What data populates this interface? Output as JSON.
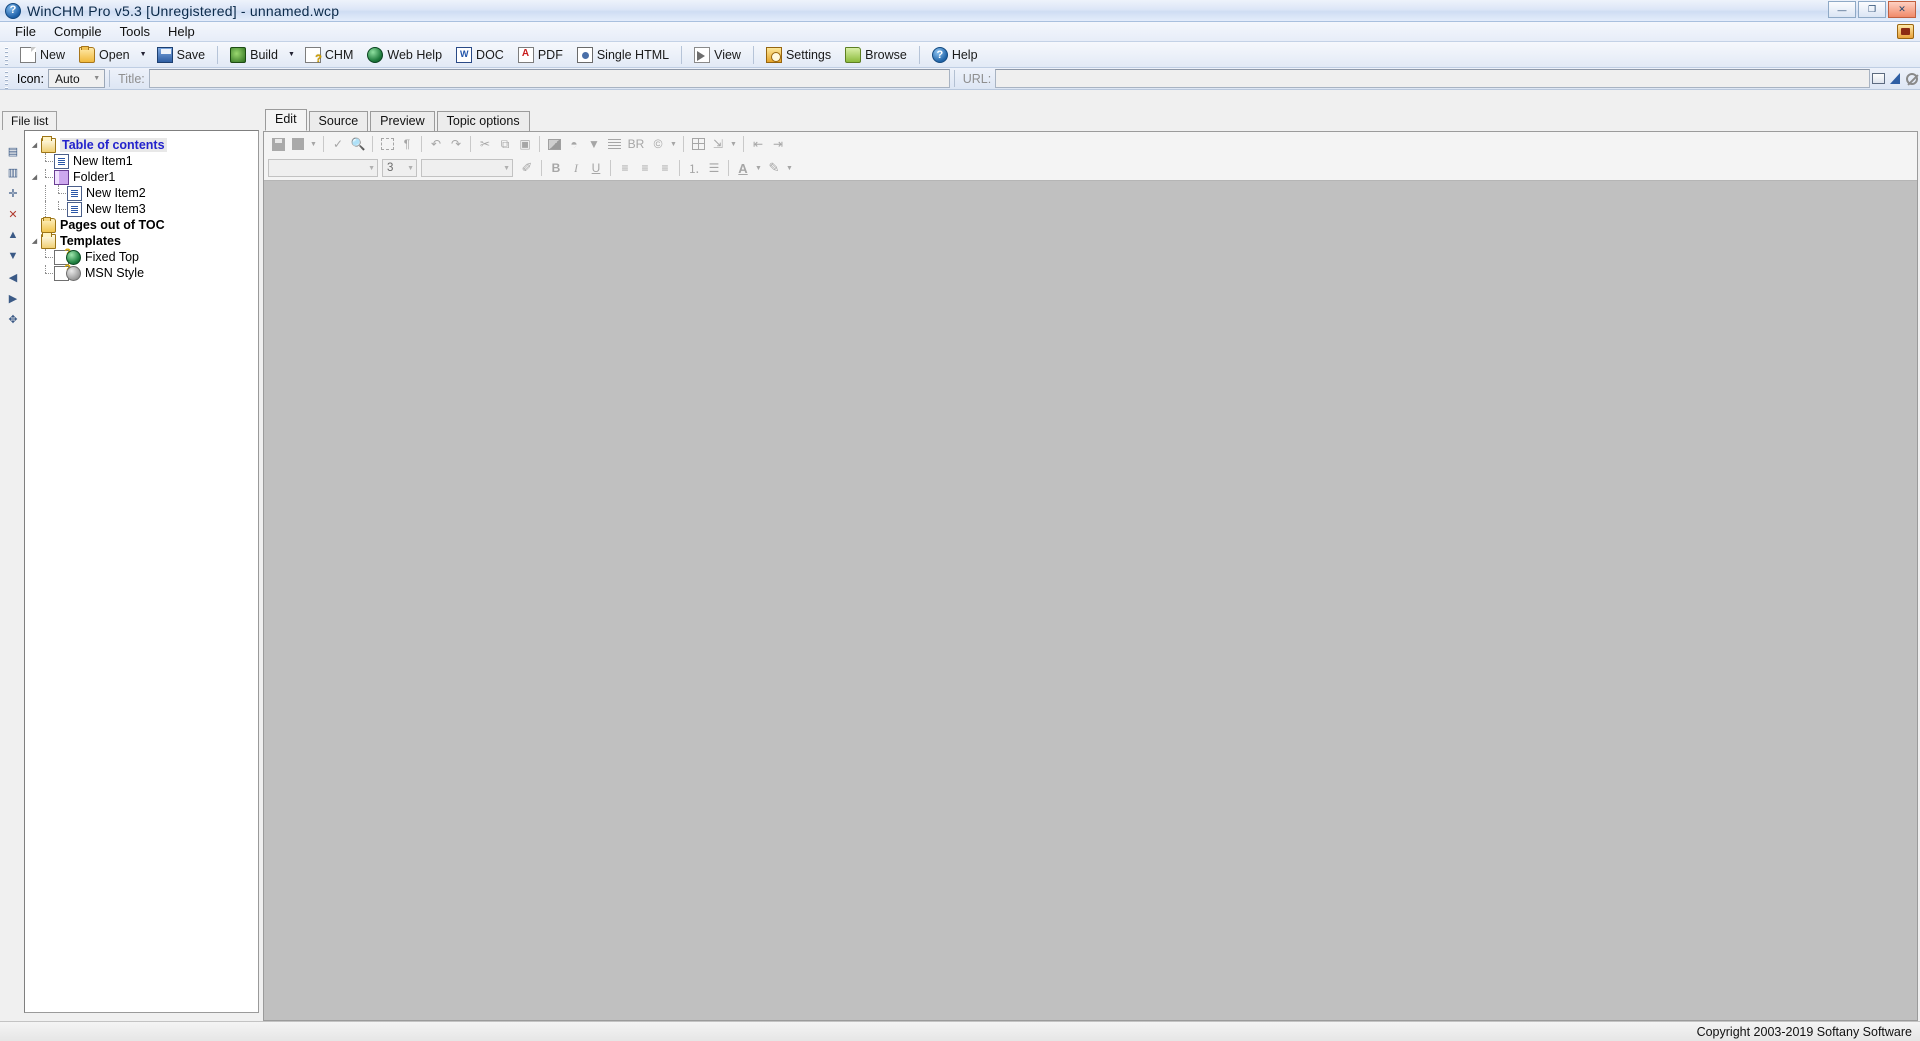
{
  "window": {
    "title": "WinCHM Pro v5.3 [Unregistered] - unnamed.wcp",
    "app_icon": "question-globe-icon",
    "minimize_label": "—",
    "maximize_label": "❐",
    "close_label": "✕"
  },
  "menu": {
    "items": [
      {
        "label": "File"
      },
      {
        "label": "Compile"
      },
      {
        "label": "Tools"
      },
      {
        "label": "Help"
      }
    ],
    "right_icon": "register-key-icon"
  },
  "toolbar": {
    "buttons": [
      {
        "label": "New",
        "icon": "new-page-icon",
        "dropdown": false
      },
      {
        "label": "Open",
        "icon": "open-folder-icon",
        "dropdown": true
      },
      {
        "label": "Save",
        "icon": "save-disk-icon",
        "dropdown": false
      },
      {
        "label": "Build",
        "icon": "build-icon",
        "dropdown": true
      },
      {
        "label": "CHM",
        "icon": "chm-file-icon",
        "dropdown": false
      },
      {
        "label": "Web Help",
        "icon": "globe-icon",
        "dropdown": false
      },
      {
        "label": "DOC",
        "icon": "word-doc-icon",
        "dropdown": false
      },
      {
        "label": "PDF",
        "icon": "pdf-icon",
        "dropdown": false
      },
      {
        "label": "Single HTML",
        "icon": "single-html-icon",
        "dropdown": false
      },
      {
        "label": "View",
        "icon": "view-icon",
        "dropdown": false
      },
      {
        "label": "Settings",
        "icon": "settings-icon",
        "dropdown": false
      },
      {
        "label": "Browse",
        "icon": "browse-icon",
        "dropdown": false
      },
      {
        "label": "Help",
        "icon": "help-icon",
        "dropdown": false
      }
    ]
  },
  "propbar": {
    "icon_label": "Icon:",
    "icon_value": "Auto",
    "title_label": "Title:",
    "title_value": "",
    "title_placeholder": "",
    "url_label": "URL:",
    "url_value": "",
    "url_placeholder": "",
    "mini_buttons": [
      {
        "name": "window-preview-icon"
      },
      {
        "name": "flag-bookmark-icon"
      },
      {
        "name": "no-entry-icon"
      }
    ]
  },
  "left_panel": {
    "tab_label": "File list",
    "side_tools": [
      {
        "name": "insert-topic-before-icon",
        "glyph": "▤",
        "state": "enabled"
      },
      {
        "name": "insert-topic-after-icon",
        "glyph": "▥",
        "state": "enabled"
      },
      {
        "name": "add-topic-icon",
        "glyph": "✛",
        "state": "enabled"
      },
      {
        "name": "delete-topic-icon",
        "glyph": "✕",
        "state": "red"
      },
      {
        "name": "move-up-icon",
        "glyph": "▲",
        "state": "enabled"
      },
      {
        "name": "move-down-icon",
        "glyph": "▼",
        "state": "enabled"
      },
      {
        "name": "move-left-icon",
        "glyph": "◀",
        "state": "enabled"
      },
      {
        "name": "move-right-icon",
        "glyph": "▶",
        "state": "enabled"
      },
      {
        "name": "move-free-icon",
        "glyph": "✥",
        "state": "enabled"
      }
    ],
    "tree": [
      {
        "label": "Table of contents",
        "icon": "open-folder-icon",
        "depth": 0,
        "toggle": "expanded",
        "style": "selected-root"
      },
      {
        "label": "New Item1",
        "icon": "page-icon",
        "depth": 1,
        "toggle": "none",
        "style": "normal"
      },
      {
        "label": "Folder1",
        "icon": "book-icon",
        "depth": 1,
        "toggle": "expanded",
        "style": "normal"
      },
      {
        "label": "New Item2",
        "icon": "page-icon",
        "depth": 2,
        "toggle": "none",
        "style": "normal"
      },
      {
        "label": "New Item3",
        "icon": "page-icon",
        "depth": 2,
        "toggle": "none",
        "style": "normal"
      },
      {
        "label": "Pages out of  TOC",
        "icon": "folder-icon",
        "depth": 0,
        "toggle": "none",
        "style": "bold"
      },
      {
        "label": "Templates",
        "icon": "open-folder-icon",
        "depth": 0,
        "toggle": "expanded",
        "style": "bold"
      },
      {
        "label": "Fixed Top",
        "icon": "template-globe-icon",
        "depth": 1,
        "toggle": "none",
        "style": "normal"
      },
      {
        "label": "MSN Style",
        "icon": "template-globe-grey-icon",
        "depth": 1,
        "toggle": "none",
        "style": "normal"
      }
    ]
  },
  "editor": {
    "tabs": [
      {
        "label": "Edit",
        "active": true
      },
      {
        "label": "Source",
        "active": false
      },
      {
        "label": "Preview",
        "active": false
      },
      {
        "label": "Topic options",
        "active": false
      }
    ],
    "toolbar_row1": [
      {
        "name": "save-icon",
        "glyph": "save",
        "dropdown": false,
        "disabled": true
      },
      {
        "name": "background-color-icon",
        "glyph": "square",
        "dropdown": true,
        "disabled": true
      },
      {
        "name": "spell-check-icon",
        "glyph": "✓",
        "dropdown": false,
        "disabled": true
      },
      {
        "name": "find-replace-icon",
        "glyph": "🔍",
        "dropdown": false,
        "disabled": true
      },
      {
        "name": "select-all-icon",
        "glyph": "▦",
        "dropdown": false,
        "disabled": true
      },
      {
        "name": "paragraph-marks-icon",
        "glyph": "¶",
        "dropdown": false,
        "disabled": true
      },
      {
        "name": "undo-icon",
        "glyph": "↶",
        "dropdown": false,
        "disabled": true
      },
      {
        "name": "redo-icon",
        "glyph": "↷",
        "dropdown": false,
        "disabled": true
      },
      {
        "name": "cut-icon",
        "glyph": "✂",
        "dropdown": false,
        "disabled": true
      },
      {
        "name": "copy-icon",
        "glyph": "⧉",
        "dropdown": false,
        "disabled": true
      },
      {
        "name": "paste-icon",
        "glyph": "📋",
        "dropdown": false,
        "disabled": true
      },
      {
        "name": "insert-image-icon",
        "glyph": "image",
        "dropdown": false,
        "disabled": true
      },
      {
        "name": "insert-object-icon",
        "glyph": "obj",
        "dropdown": false,
        "disabled": true
      },
      {
        "name": "filter-icon",
        "glyph": "▼",
        "dropdown": false,
        "disabled": true
      },
      {
        "name": "line-spacing-icon",
        "glyph": "lines",
        "dropdown": false,
        "disabled": true
      },
      {
        "name": "insert-br-icon",
        "glyph": "BR",
        "dropdown": false,
        "disabled": true
      },
      {
        "name": "insert-symbol-icon",
        "glyph": "©",
        "dropdown": true,
        "disabled": true
      },
      {
        "name": "insert-table-icon",
        "glyph": "table",
        "dropdown": false,
        "disabled": true
      },
      {
        "name": "insert-link-icon",
        "glyph": "link",
        "dropdown": true,
        "disabled": true
      },
      {
        "name": "decrease-indent-icon",
        "glyph": "⇤",
        "dropdown": false,
        "disabled": true
      },
      {
        "name": "increase-indent-icon",
        "glyph": "⇥",
        "dropdown": false,
        "disabled": true
      }
    ],
    "font_family_value": "",
    "font_size_value": "3",
    "style_value": "",
    "toolbar_row2": [
      {
        "name": "clear-format-icon",
        "glyph": "🧹",
        "disabled": true
      },
      {
        "name": "bold-icon",
        "glyph": "B",
        "disabled": true
      },
      {
        "name": "italic-icon",
        "glyph": "I",
        "disabled": true
      },
      {
        "name": "underline-icon",
        "glyph": "U",
        "disabled": true
      },
      {
        "name": "align-left-icon",
        "glyph": "≡",
        "disabled": true
      },
      {
        "name": "align-center-icon",
        "glyph": "≡",
        "disabled": true
      },
      {
        "name": "align-right-icon",
        "glyph": "≡",
        "disabled": true
      },
      {
        "name": "numbered-list-icon",
        "glyph": "1.",
        "disabled": true
      },
      {
        "name": "bullet-list-icon",
        "glyph": "•",
        "disabled": true
      },
      {
        "name": "font-color-icon",
        "glyph": "A",
        "disabled": true,
        "dropdown": true
      },
      {
        "name": "highlight-color-icon",
        "glyph": "✎",
        "disabled": true,
        "dropdown": true
      }
    ],
    "canvas_color": "#c0c0c0"
  },
  "statusbar": {
    "copyright": "Copyright 2003-2019 Softany Software"
  },
  "colors": {
    "title_text": "#0b2a4a",
    "toc_accent": "#2222cc",
    "canvas": "#c0c0c0",
    "disabled_glyph": "#a6a6a6"
  }
}
